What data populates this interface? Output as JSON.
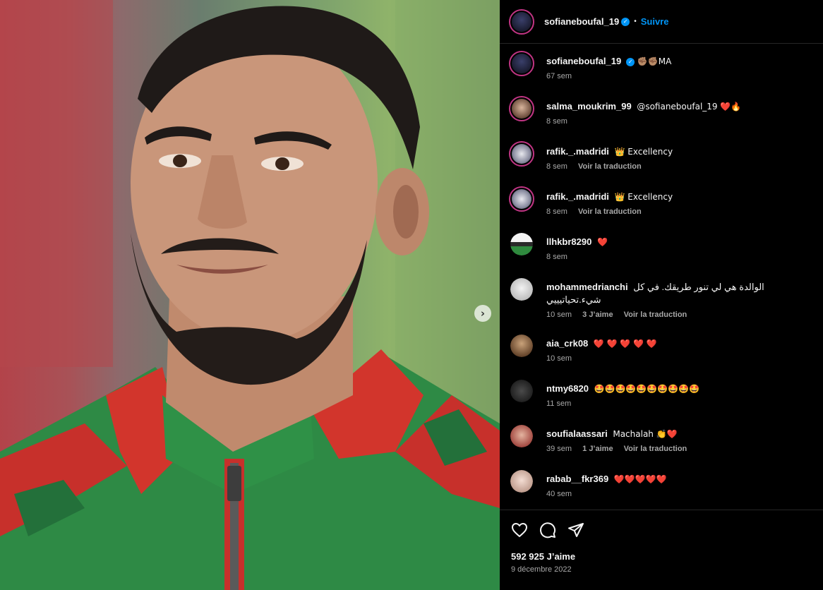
{
  "post": {
    "author": "sofianeboufal_19",
    "follow_label": "Suivre",
    "separator": "•",
    "caption": "✊🏽✊🏽MA",
    "caption_time": "67 sem",
    "likes": "592 925 J’aime",
    "date": "9 décembre 2022"
  },
  "comments": [
    {
      "user": "salma_moukrim_99",
      "text": "@sofianeboufal_19 ❤️🔥",
      "time": "8 sem",
      "likes": "",
      "translate": ""
    },
    {
      "user": "rafik._.madridi",
      "text": "👑 Excellency",
      "time": "8 sem",
      "likes": "",
      "translate": "Voir la traduction"
    },
    {
      "user": "rafik._.madridi",
      "text": "👑 Excellency",
      "time": "8 sem",
      "likes": "",
      "translate": "Voir la traduction"
    },
    {
      "user": "llhkbr8290",
      "text": "❤️",
      "time": "8 sem",
      "likes": "",
      "translate": ""
    },
    {
      "user": "mohammedrianchi",
      "text": "الوالدة هي لي تنور طريقك. في كل شيء.تحياتيييي",
      "time": "10 sem",
      "likes": "3 J’aime",
      "translate": "Voir la traduction"
    },
    {
      "user": "aia_crk08",
      "text": "❤️ ❤️ ❤️ ❤️ ❤️",
      "time": "10 sem",
      "likes": "",
      "translate": ""
    },
    {
      "user": "ntmy6820",
      "text": "🤩🤩🤩🤩🤩🤩🤩🤩🤩🤩",
      "time": "11 sem",
      "likes": "",
      "translate": ""
    },
    {
      "user": "soufialaassari",
      "text": "Machalah 👏❤️",
      "time": "39 sem",
      "likes": "1 J’aime",
      "translate": "Voir la traduction"
    },
    {
      "user": "rabab__fkr369",
      "text": "❤️❤️❤️❤️❤️",
      "time": "40 sem",
      "likes": "",
      "translate": ""
    }
  ],
  "icons": {
    "next": "chevron-right-icon",
    "like": "heart-icon",
    "comment": "comment-bubble-icon",
    "share": "paper-plane-icon",
    "verified": "verified-badge-icon"
  },
  "colors": {
    "background": "#000000",
    "accent_blue": "#0095f6",
    "meta_gray": "#a8a8a8",
    "story_ring": "#c13584",
    "heart_red": "#ed4956"
  }
}
